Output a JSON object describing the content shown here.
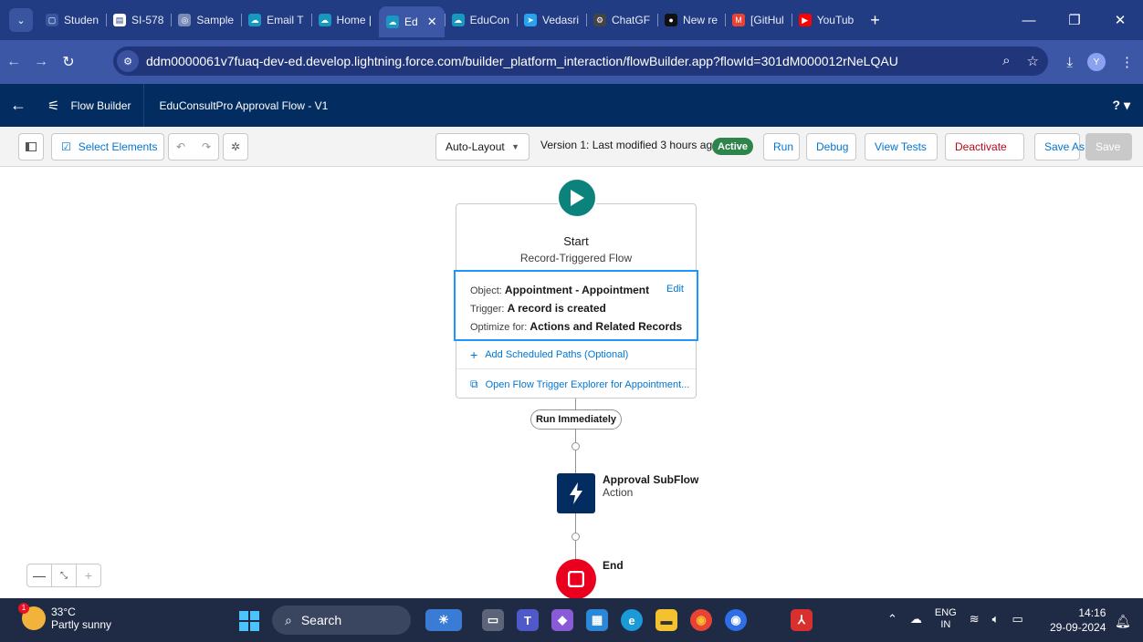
{
  "browser": {
    "tabs": [
      {
        "label": "Studen",
        "color": "#3a55a0",
        "glyph": "▢"
      },
      {
        "label": "SI-578",
        "color": "#ffffff",
        "glyph": "▤"
      },
      {
        "label": "Sample",
        "color": "#7a8bb8",
        "glyph": "◎"
      },
      {
        "label": "Email T",
        "color": "#1798c1",
        "glyph": "☁"
      },
      {
        "label": "Home |",
        "color": "#1798c1",
        "glyph": "☁"
      },
      {
        "label": "Ed",
        "color": "#1798c1",
        "glyph": "☁",
        "active": true
      },
      {
        "label": "EduCon",
        "color": "#1798c1",
        "glyph": "☁"
      },
      {
        "label": "Vedasri",
        "color": "#2aa3ee",
        "glyph": "➤"
      },
      {
        "label": "ChatGF",
        "color": "#444444",
        "glyph": "⚙"
      },
      {
        "label": "New re",
        "color": "#111111",
        "glyph": "●"
      },
      {
        "label": "[GitHul",
        "color": "#ea4335",
        "glyph": "M"
      },
      {
        "label": "YouTub",
        "color": "#ff0000",
        "glyph": "▶"
      }
    ],
    "close_tab": "✕",
    "new_tab": "+",
    "url": "ddm0000061v7fuaq-dev-ed.develop.lightning.force.com/builder_platform_interaction/flowBuilder.app?flowId=301dM000012rNeLQAU",
    "profile_initial": "Y"
  },
  "header": {
    "app_name": "Flow Builder",
    "flow_name": "EduConsultPro Approval Flow - V1",
    "help": "? ▾"
  },
  "toolbar": {
    "select_elements": "Select Elements",
    "auto_layout": "Auto-Layout",
    "version_text": "Version 1: Last modified 3 hours ago",
    "status_badge": "Active",
    "run": "Run",
    "debug": "Debug",
    "view_tests": "View Tests",
    "deactivate": "Deactivate",
    "save_as": "Save As",
    "save": "Save"
  },
  "canvas": {
    "start": {
      "title": "Start",
      "subtitle": "Record-Triggered Flow",
      "object_label": "Object:",
      "object_value": "Appointment - Appointment",
      "edit": "Edit",
      "trigger_label": "Trigger:",
      "trigger_value": "A record is created",
      "optimize_label": "Optimize for:",
      "optimize_value": "Actions and Related Records",
      "add_paths": "Add Scheduled Paths (Optional)",
      "open_explorer": "Open Flow Trigger Explorer for Appointment..."
    },
    "path_label": "Run Immediately",
    "action": {
      "title": "Approval SubFlow",
      "subtitle": "Action"
    },
    "end": {
      "title": "End"
    }
  },
  "taskbar": {
    "temp": "33°C",
    "weather": "Partly sunny",
    "weather_alert": "1",
    "search": "Search",
    "lang_top": "ENG",
    "lang_bottom": "IN",
    "time": "14:16",
    "date": "29-09-2024"
  }
}
